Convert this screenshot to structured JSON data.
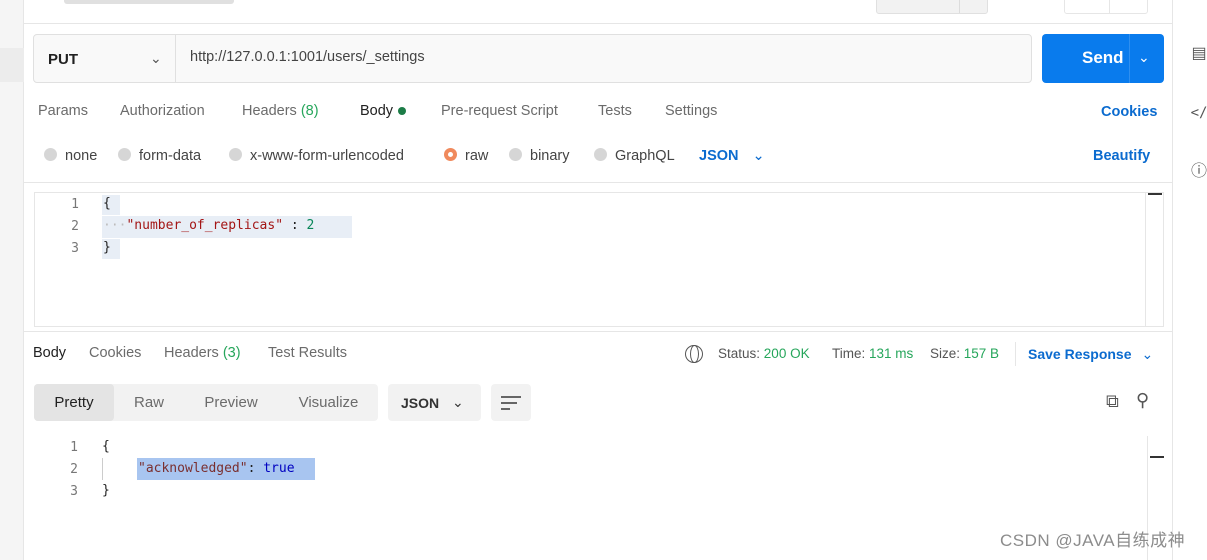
{
  "request": {
    "method": "PUT",
    "url": "http://127.0.0.1:1001/users/_settings",
    "send_label": "Send",
    "tabs": [
      {
        "label": "Params"
      },
      {
        "label": "Authorization"
      },
      {
        "label": "Headers",
        "count": "(8)"
      },
      {
        "label": "Body"
      },
      {
        "label": "Pre-request Script"
      },
      {
        "label": "Tests"
      },
      {
        "label": "Settings"
      }
    ],
    "cookies_link": "Cookies",
    "body_options": [
      "none",
      "form-data",
      "x-www-form-urlencoded",
      "raw",
      "binary",
      "GraphQL"
    ],
    "body_selected": "raw",
    "body_format": "JSON",
    "beautify_link": "Beautify",
    "editor": {
      "line_numbers": [
        "1",
        "2",
        "3"
      ],
      "line1": "{",
      "line2_indent": "···",
      "line2_key": "\"number_of_replicas\"",
      "line2_sep": " : ",
      "line2_value": "2",
      "line3": "}"
    }
  },
  "response": {
    "tabs": [
      {
        "label": "Body"
      },
      {
        "label": "Cookies"
      },
      {
        "label": "Headers",
        "count": "(3)"
      },
      {
        "label": "Test Results"
      }
    ],
    "status_label": "Status:",
    "status_value": "200 OK",
    "time_label": "Time:",
    "time_value": "131 ms",
    "size_label": "Size:",
    "size_value": "157 B",
    "save_response": "Save Response",
    "views": [
      "Pretty",
      "Raw",
      "Preview",
      "Visualize"
    ],
    "active_view": "Pretty",
    "format": "JSON",
    "body": {
      "line_numbers": [
        "1",
        "2",
        "3"
      ],
      "line1": "{",
      "line2_key": "\"acknowledged\"",
      "line2_sep": ": ",
      "line2_value": "true",
      "line3": "}"
    }
  },
  "icons": {
    "right_rail": [
      "comment-icon",
      "code-icon",
      "info-icon"
    ]
  },
  "watermark": "CSDN @JAVA自练成神"
}
